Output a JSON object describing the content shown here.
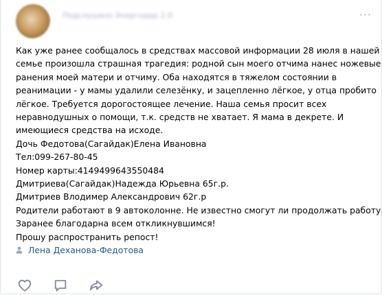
{
  "post": {
    "author_name": "Подслушано Энергодар 2.0",
    "more_glyph": "···",
    "lines": [
      "Как уже ранее сообщалось в средствах массовой информации 28 июля в нашей",
      "семье произошла страшная трагедия: родной сын моего отчима нанес ножевые",
      "ранения моей матери и отчиму. Оба находятся в тяжелом состоянии в",
      "реанимации - у мамы удалили селезёнку, и зацепленно лёгкое, у отца пробито",
      "лёгкое. Требуется дорогостоящее лечение. Наша семья просит всех",
      "неравнодушных о помощи, т.к. средств не хватает. Я мама в декрете. И",
      "имеющиеся средства на исходе.",
      "Дочь Федотова(Сагайдак)Елена Ивановна",
      "Тел:099-267-80-45",
      "Номер карты:4149499643550484",
      "Дмитриева(Сагайдак)Надежда Юрьевна 65г.р.",
      "Дмитриев Влодимер Александрович 62г.р",
      "Родители работают в 9 автоколонне. Не известно смогут ли продолжать работу.",
      "Заранее благодарна всем откликнувшимся!",
      "Прошу распространить репост!"
    ],
    "signer": "Лена Деханова-Федотова"
  },
  "actions": [
    {
      "icon": "heart-icon"
    },
    {
      "icon": "comment-icon"
    },
    {
      "icon": "share-icon"
    }
  ],
  "colors": {
    "link": "#2a5885",
    "icon": "#828a99",
    "border": "#dce1e6"
  }
}
